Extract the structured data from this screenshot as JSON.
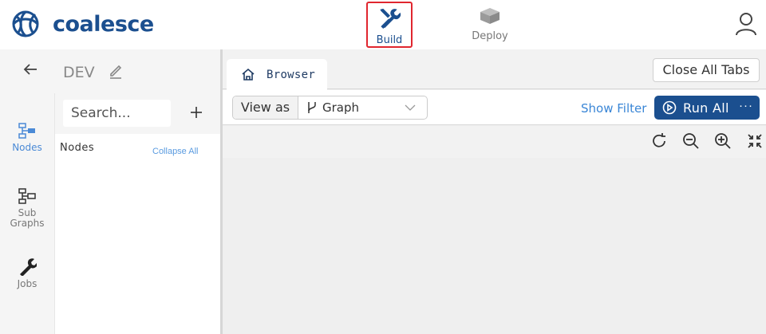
{
  "brand": {
    "name": "coalesce",
    "color": "#1b4f8f"
  },
  "nav": {
    "build_label": "Build",
    "deploy_label": "Deploy"
  },
  "env": {
    "name": "DEV"
  },
  "rail": {
    "items": [
      {
        "label": "Nodes",
        "icon": "nodes-icon",
        "active": true
      },
      {
        "label": "Sub Graphs",
        "icon": "subgraphs-icon",
        "active": false
      },
      {
        "label": "Jobs",
        "icon": "wrench-icon",
        "active": false
      }
    ]
  },
  "panel": {
    "search_placeholder": "Search...",
    "title": "Nodes",
    "collapse_label": "Collapse All"
  },
  "tabs": {
    "browser_label": "Browser",
    "close_all_label": "Close All Tabs"
  },
  "toolbar": {
    "view_as_label": "View as",
    "view_value": "Graph",
    "show_filter_label": "Show Filter",
    "run_all_label": "Run All",
    "more_label": "···"
  },
  "colors": {
    "accent": "#1b4f8f",
    "link": "#3a86d6",
    "highlight": "#e0262f"
  }
}
